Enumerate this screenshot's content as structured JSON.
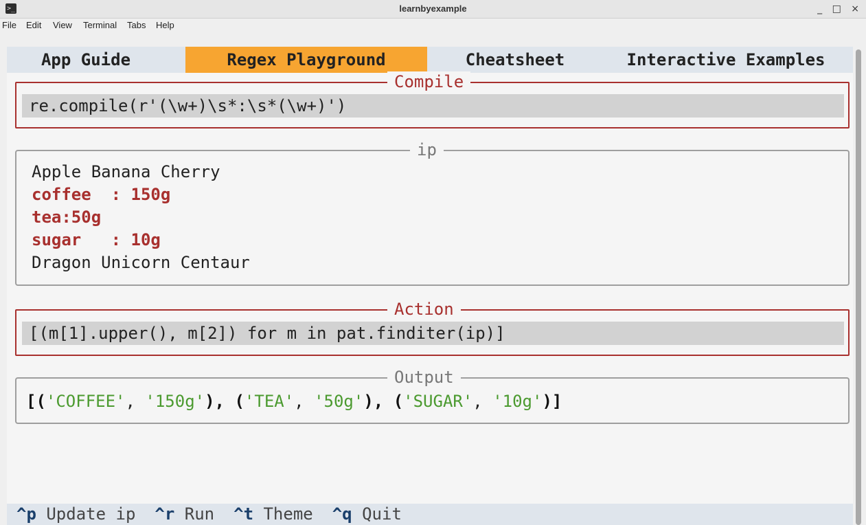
{
  "window": {
    "title": "learnbyexample",
    "controls": [
      "_",
      "□",
      "×"
    ]
  },
  "menu": [
    "File",
    "Edit",
    "View",
    "Terminal",
    "Tabs",
    "Help"
  ],
  "tabs": [
    {
      "label": "App Guide"
    },
    {
      "label": "Regex Playground",
      "active": true
    },
    {
      "label": "Cheatsheet"
    },
    {
      "label": "Interactive Examples"
    }
  ],
  "compile": {
    "legend": "Compile",
    "value": "re.compile(r'(\\w+)\\s*:\\s*(\\w+)')"
  },
  "ip": {
    "legend": "ip",
    "lines": [
      {
        "text": "Apple Banana Cherry",
        "highlighted": false
      },
      {
        "text": "coffee  : 150g",
        "highlighted": true
      },
      {
        "text": "tea:50g",
        "highlighted": true
      },
      {
        "text": "sugar   : 10g",
        "highlighted": true
      },
      {
        "text": "Dragon Unicorn Centaur",
        "highlighted": false
      }
    ]
  },
  "action": {
    "legend": "Action",
    "value": "[(m[1].upper(), m[2]) for m in pat.finditer(ip)]"
  },
  "output": {
    "legend": "Output",
    "tokens": [
      {
        "t": "[(",
        "c": "b"
      },
      {
        "t": "'COFFEE'",
        "c": "s"
      },
      {
        "t": ", ",
        "c": "n"
      },
      {
        "t": "'150g'",
        "c": "s"
      },
      {
        "t": "), ",
        "c": "b"
      },
      {
        "t": "(",
        "c": "b"
      },
      {
        "t": "'TEA'",
        "c": "s"
      },
      {
        "t": ", ",
        "c": "n"
      },
      {
        "t": "'50g'",
        "c": "s"
      },
      {
        "t": "), ",
        "c": "b"
      },
      {
        "t": "(",
        "c": "b"
      },
      {
        "t": "'SUGAR'",
        "c": "s"
      },
      {
        "t": ", ",
        "c": "n"
      },
      {
        "t": "'10g'",
        "c": "s"
      },
      {
        "t": ")]",
        "c": "b"
      }
    ]
  },
  "status": [
    {
      "key": "^p",
      "label": "Update ip"
    },
    {
      "key": "^r",
      "label": "Run"
    },
    {
      "key": "^t",
      "label": "Theme"
    },
    {
      "key": "^q",
      "label": "Quit"
    }
  ],
  "colors": {
    "active_tab": "#f7a531",
    "accent_red": "#a8302e",
    "string_green": "#4b9a2f",
    "key_blue": "#1a3f6b"
  }
}
